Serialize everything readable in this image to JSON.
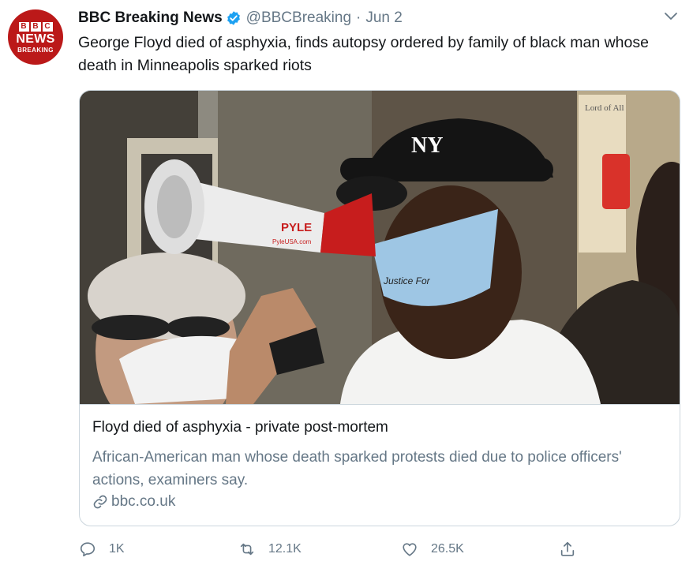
{
  "account": {
    "name": "BBC Breaking News",
    "handle": "@BBCBreaking",
    "separator": "·",
    "date": "Jun 2",
    "avatar": {
      "top_letters": [
        "B",
        "B",
        "C"
      ],
      "line1": "NEWS",
      "line2": "BREAKING",
      "color": "#bb1919"
    }
  },
  "tweet": {
    "text": "George Floyd died of asphyxia, finds autopsy ordered by family of black man whose death in Minneapolis sparked riots"
  },
  "card": {
    "image_text": {
      "megaphone_brand": "PYLE",
      "megaphone_url": "PyleUSA.com",
      "mask_text": "Justice For",
      "cap_logo": "NY",
      "sign_text": "Lord of All"
    },
    "title": "Floyd died of asphyxia - private post-mortem",
    "description": "African-American man whose death sparked protests died due to police officers' actions, examiners say.",
    "link": "bbc.co.uk",
    "link_icon": "link-icon"
  },
  "actions": {
    "reply": {
      "icon": "reply-icon",
      "count": "1K"
    },
    "retweet": {
      "icon": "retweet-icon",
      "count": "12.1K"
    },
    "like": {
      "icon": "heart-icon",
      "count": "26.5K"
    },
    "share": {
      "icon": "share-icon"
    }
  },
  "colors": {
    "secondary_text": "#657786",
    "border": "#ccd6dd",
    "verified": "#1da1f2"
  }
}
